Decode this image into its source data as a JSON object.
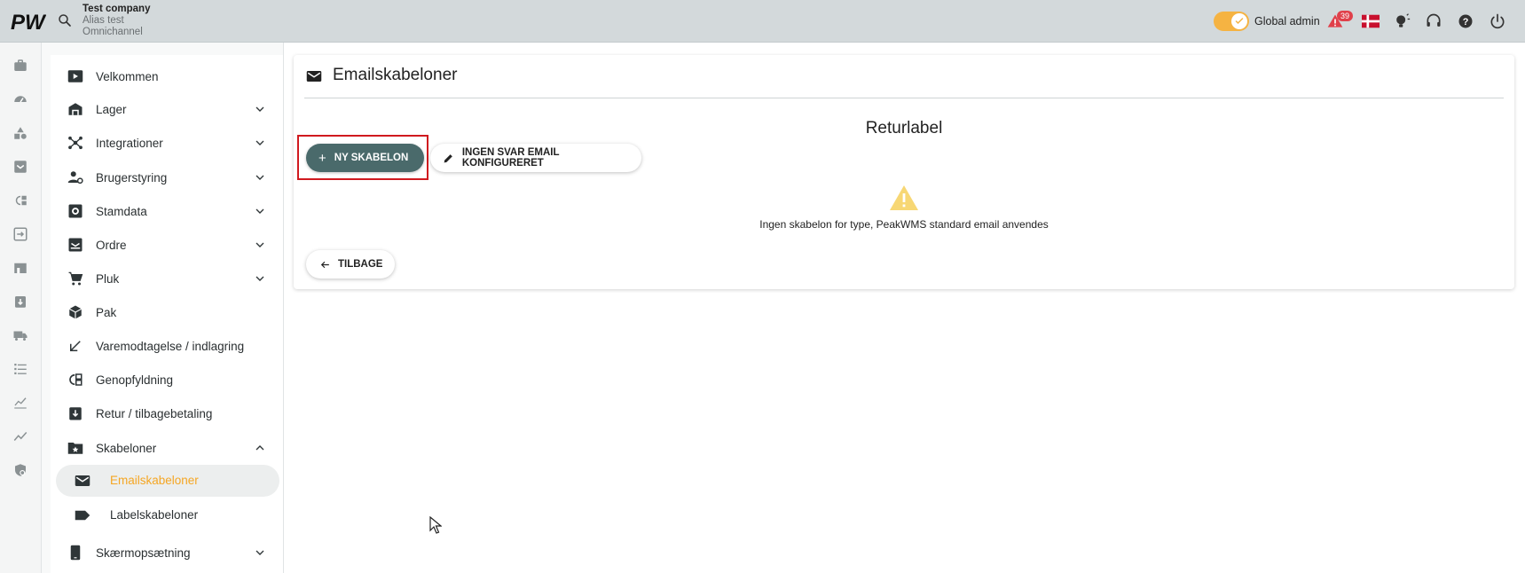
{
  "header": {
    "logo_text": "PW",
    "company_name": "Test company",
    "alias": "Alias test",
    "channel": "Omnichannel",
    "admin_toggle_label": "Global admin",
    "alerts_count": "39",
    "icons": [
      "search-icon",
      "alert-icon",
      "danish-flag-icon",
      "lightbulb-icon",
      "support-icon",
      "help-icon",
      "power-icon"
    ]
  },
  "colors": {
    "topbar": "#d3d9db",
    "accent": "#f5a623",
    "primary_button": "#4a6a6b",
    "highlight_border": "#d0191f",
    "warning": "#f7d774"
  },
  "rail": {
    "icons": [
      "briefcase-icon",
      "dashboard-icon",
      "shapes-icon",
      "inbox-icon",
      "replenish-icon",
      "import-icon",
      "store-icon",
      "return-icon",
      "truck-icon",
      "list-icon",
      "chart-icon",
      "trend-icon",
      "shield-icon"
    ]
  },
  "sidebar": {
    "items": [
      {
        "label": "Velkommen",
        "icon": "play-icon",
        "expandable": false
      },
      {
        "label": "Lager",
        "icon": "warehouse-icon",
        "expandable": true
      },
      {
        "label": "Integrationer",
        "icon": "hub-icon",
        "expandable": true
      },
      {
        "label": "Brugerstyring",
        "icon": "user-settings-icon",
        "expandable": true
      },
      {
        "label": "Stamdata",
        "icon": "master-data-icon",
        "expandable": true
      },
      {
        "label": "Ordre",
        "icon": "orders-icon",
        "expandable": true
      },
      {
        "label": "Pluk",
        "icon": "cart-icon",
        "expandable": true
      },
      {
        "label": "Pak",
        "icon": "package-icon",
        "expandable": false
      },
      {
        "label": "Varemodtagelse / indlagring",
        "icon": "arrow-down-left-icon",
        "expandable": false
      },
      {
        "label": "Genopfyldning",
        "icon": "replenish-icon",
        "expandable": false
      },
      {
        "label": "Retur / tilbagebetaling",
        "icon": "return-icon",
        "expandable": false
      },
      {
        "label": "Skabeloner",
        "icon": "folder-star-icon",
        "expandable": true,
        "expanded": true
      }
    ],
    "sub_items": [
      {
        "label": "Emailskabeloner",
        "icon": "mail-icon",
        "active": true
      },
      {
        "label": "Labelskabeloner",
        "icon": "label-icon",
        "active": false
      }
    ],
    "last_item": {
      "label": "Skærmopsætning",
      "icon": "tablet-icon",
      "expandable": true
    }
  },
  "main": {
    "title": "Emailskabeloner",
    "section_title": "Returlabel",
    "new_template_button": "NY SKABELON",
    "no_reply_button": "INGEN SVAR EMAIL KONFIGURERET",
    "empty_message": "Ingen skabelon for type, PeakWMS standard email anvendes",
    "back_button": "TILBAGE"
  }
}
